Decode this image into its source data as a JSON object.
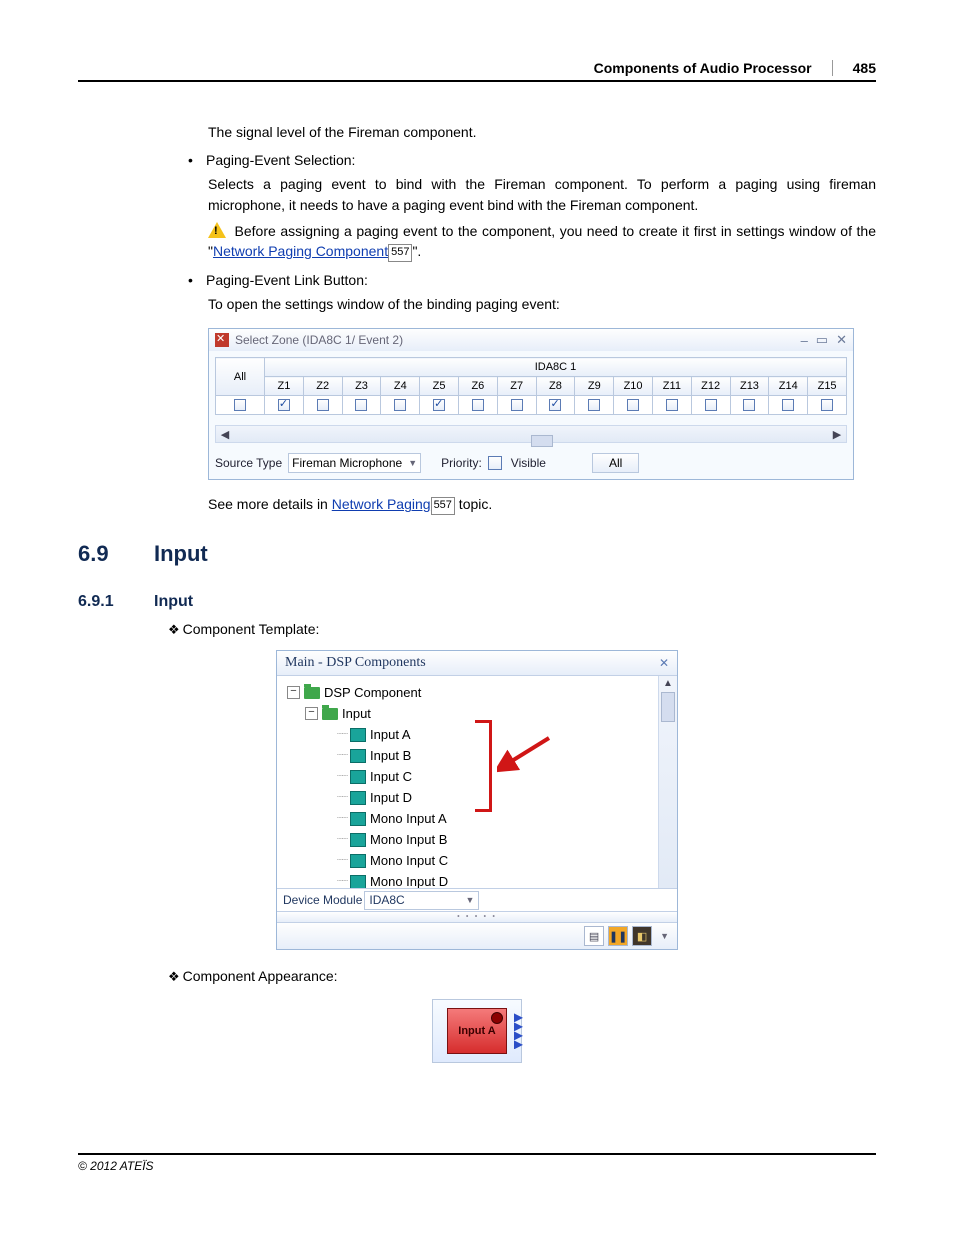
{
  "header": {
    "title": "Components of Audio Processor",
    "page": "485"
  },
  "body": {
    "p1": "The signal level of the Fireman component.",
    "b1": "Paging-Event Selection:",
    "p2": "Selects a paging event to bind with the Fireman component. To perform a paging using fireman microphone, it needs to have a paging event bind with the Fireman component.",
    "p3a": "Before assigning a paging event to the component, you need to create it first in settings window of the \"",
    "link1": "Network Paging Component",
    "ref1": "557",
    "p3b": "\".",
    "b2": "Paging-Event Link Button:",
    "p4": "To open the settings window of the binding paging event:",
    "p5a": "See more details in ",
    "link2": "Network Paging",
    "ref2": "557",
    "p5b": " topic."
  },
  "zone": {
    "title": "Select Zone (IDA8C 1/ Event 2)",
    "device": "IDA8C 1",
    "all": "All",
    "cols": [
      "Z1",
      "Z2",
      "Z3",
      "Z4",
      "Z5",
      "Z6",
      "Z7",
      "Z8",
      "Z9",
      "Z10",
      "Z11",
      "Z12",
      "Z13",
      "Z14",
      "Z15"
    ],
    "checked": [
      true,
      false,
      false,
      false,
      true,
      false,
      false,
      true,
      false,
      false,
      false,
      false,
      false,
      false,
      false
    ],
    "sourceTypeLabel": "Source Type",
    "sourceTypeValue": "Fireman Microphone",
    "priorityLabel": "Priority:",
    "visibleLabel": "Visible",
    "allBtn": "All"
  },
  "sec1": {
    "num": "6.9",
    "title": "Input"
  },
  "sec2": {
    "num": "6.9.1",
    "title": "Input"
  },
  "comp_template_label": "Component Template:",
  "comp_appearance_label": "Component Appearance:",
  "dsp": {
    "title": "Main - DSP Components",
    "root": "DSP Component",
    "folder": "Input",
    "items": [
      "Input A",
      "Input B",
      "Input C",
      "Input D",
      "Mono Input A",
      "Mono Input B",
      "Mono Input C",
      "Mono Input D"
    ],
    "devModLabel": "Device Module",
    "devModValue": "IDA8C"
  },
  "appearance": {
    "label": "Input A"
  },
  "footer": "© 2012 ATEÏS"
}
